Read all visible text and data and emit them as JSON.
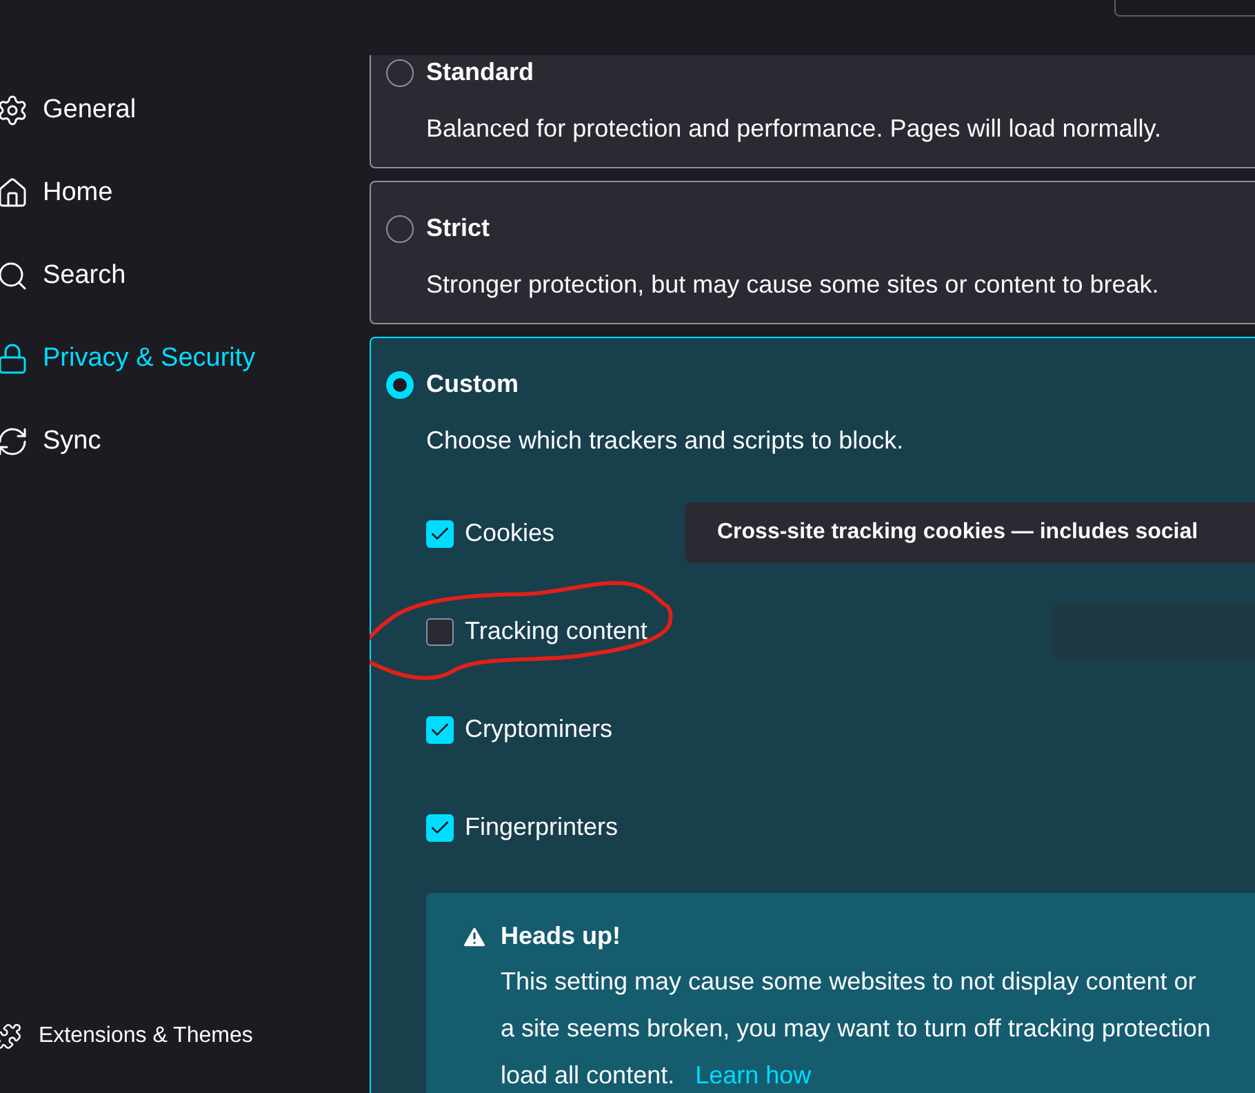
{
  "sidebar": {
    "items": [
      {
        "label": "General",
        "selected": false
      },
      {
        "label": "Home",
        "selected": false
      },
      {
        "label": "Search",
        "selected": false
      },
      {
        "label": "Privacy & Security",
        "selected": true
      },
      {
        "label": "Sync",
        "selected": false
      }
    ],
    "footer_items": [
      {
        "label": "Extensions & Themes"
      }
    ]
  },
  "protection_levels": [
    {
      "title": "Standard",
      "description": "Balanced for protection and performance. Pages will load normally.",
      "selected": false
    },
    {
      "title": "Strict",
      "description": "Stronger protection, but may cause some sites or content to break.",
      "selected": false
    },
    {
      "title": "Custom",
      "description": "Choose which trackers and scripts to block.",
      "selected": true,
      "options": [
        {
          "label": "Cookies",
          "checked": true
        },
        {
          "label": "Tracking content",
          "checked": false
        },
        {
          "label": "Cryptominers",
          "checked": true
        },
        {
          "label": "Fingerprinters",
          "checked": true
        }
      ],
      "dropdown_text": "Cross-site tracking cookies — includes social",
      "warning": {
        "title": "Heads up!",
        "lines": [
          "This setting may cause some websites to not display content or",
          "a site seems broken, you may want to turn off tracking protection",
          "load all content."
        ],
        "link": "Learn how"
      }
    }
  ]
}
